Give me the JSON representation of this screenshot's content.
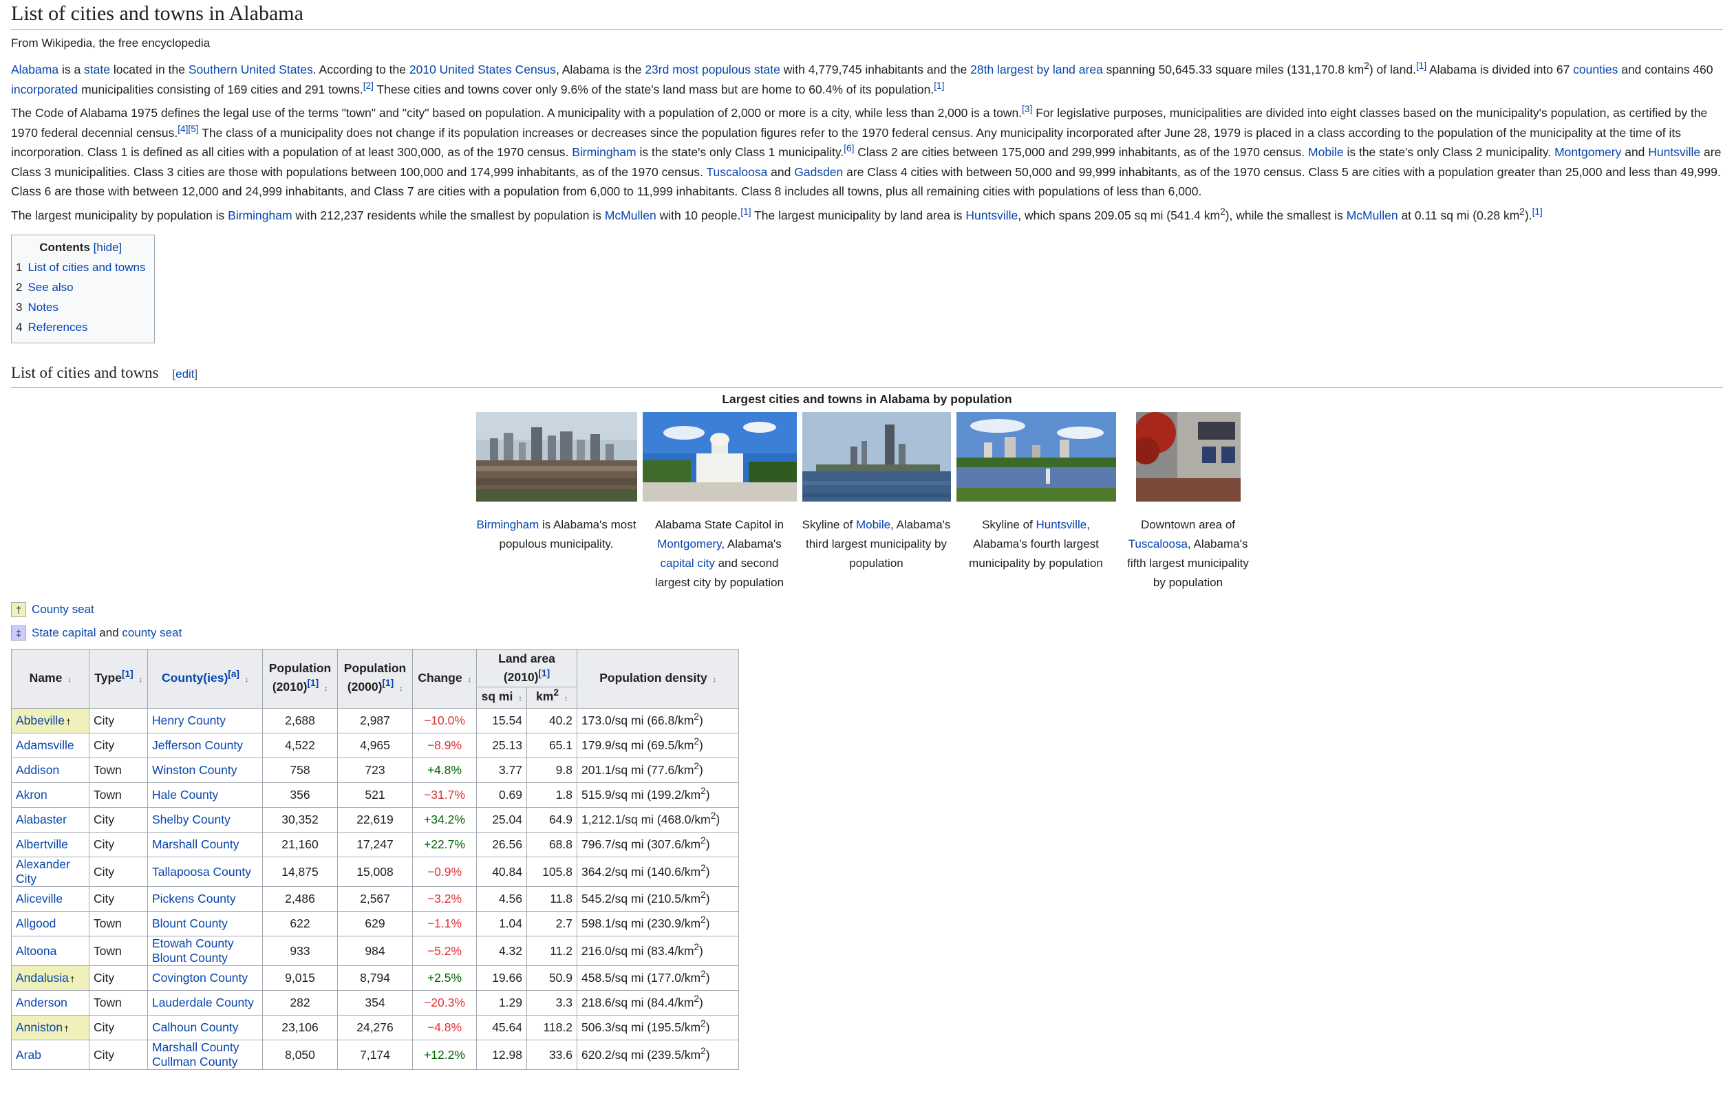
{
  "page": {
    "title": "List of cities and towns in Alabama",
    "tagline": "From Wikipedia, the free encyclopedia"
  },
  "intro": {
    "p1": {
      "alabama": "Alabama",
      "t1": " is a ",
      "state": "state",
      "t2": " located in the ",
      "southern_us": "Southern United States",
      "t3": ". According to the ",
      "census": "2010 United States Census",
      "t4": ", Alabama is the ",
      "populous": "23rd most populous state",
      "t5": " with 4,779,745 inhabitants and the ",
      "largest_area": "28th largest by land area",
      "t6": " spanning 50,645.33 square miles (131,170.8 km",
      "sup2": "2",
      "t7": ") of land.",
      "ref1": "[1]",
      "t8": " Alabama is divided into 67 ",
      "counties": "counties",
      "t9": " and contains 460 ",
      "incorporated": "incorporated",
      "t10": " municipalities consisting of 169 cities and 291 towns.",
      "ref2": "[2]",
      "t11": " These cities and towns cover only 9.6% of the state's land mass but are home to 60.4% of its population.",
      "ref1b": "[1]"
    },
    "p2": {
      "t1": "The Code of Alabama 1975 defines the legal use of the terms \"town\" and \"city\" based on population. A municipality with a population of 2,000 or more is a city, while less than 2,000 is a town.",
      "ref3": "[3]",
      "t2": " For legislative purposes, municipalities are divided into eight classes based on the municipality's population, as certified by the 1970 federal decennial census.",
      "ref45": "[4][5]",
      "t3": " The class of a municipality does not change if its population increases or decreases since the population figures refer to the 1970 federal census. Any municipality incorporated after June 28, 1979 is placed in a class according to the population of the municipality at the time of its incorporation. Class 1 is defined as all cities with a population of at least 300,000, as of the 1970 census. ",
      "birmingham": "Birmingham",
      "t4": " is the state's only Class 1 municipality.",
      "ref6": "[6]",
      "t5": " Class 2 are cities between 175,000 and 299,999 inhabitants, as of the 1970 census. ",
      "mobile": "Mobile",
      "t6": " is the state's only Class 2 municipality. ",
      "montgomery": "Montgomery",
      "t7": " and ",
      "huntsville": "Huntsville",
      "t8": " are Class 3 municipalities. Class 3 cities are those with populations between 100,000 and 174,999 inhabitants, as of the 1970 census. ",
      "tuscaloosa": "Tuscaloosa",
      "t9": " and ",
      "gadsden": "Gadsden",
      "t10": " are Class 4 cities with between 50,000 and 99,999 inhabitants, as of the 1970 census. Class 5 are cities with a population greater than 25,000 and less than 49,999. Class 6 are those with between 12,000 and 24,999 inhabitants, and Class 7 are cities with a population from 6,000 to 11,999 inhabitants. Class 8 includes all towns, plus all remaining cities with populations of less than 6,000."
    },
    "p3": {
      "t1": "The largest municipality by population is ",
      "birmingham": "Birmingham",
      "t2": " with 212,237 residents while the smallest by population is ",
      "mcmullen": "McMullen",
      "t3": " with 10 people.",
      "ref1": "[1]",
      "t4": " The largest municipality by land area is ",
      "huntsville": "Huntsville",
      "t5": ", which spans 209.05 sq mi (541.4 km",
      "sup2": "2",
      "t6": "), while the smallest is ",
      "mcmullen2": "McMullen",
      "t7": " at 0.11 sq mi (0.28 km",
      "sup2b": "2",
      "t8": ").",
      "ref1b": "[1]"
    }
  },
  "toc": {
    "title": "Contents",
    "hide": "[hide]",
    "items": [
      {
        "num": "1",
        "label": "List of cities and towns"
      },
      {
        "num": "2",
        "label": "See also"
      },
      {
        "num": "3",
        "label": "Notes"
      },
      {
        "num": "4",
        "label": "References"
      }
    ]
  },
  "section": {
    "title": "List of cities and towns",
    "edit": "edit",
    "lb": "[",
    "rb": "]"
  },
  "gallery": {
    "title": "Largest cities and towns in Alabama by population",
    "items": [
      {
        "link": "Birmingham",
        "text": " is Alabama's most populous municipality."
      },
      {
        "pre": "Alabama State Capitol in ",
        "link": "Montgomery",
        "mid": ", Alabama's ",
        "link2": "capital city",
        "text": " and second largest city by population"
      },
      {
        "pre": "Skyline of ",
        "link": "Mobile",
        "text": ", Alabama's third largest municipality by population"
      },
      {
        "pre": "Skyline of ",
        "link": "Huntsville",
        "text": ", Alabama's fourth largest municipality by population"
      },
      {
        "pre": "Downtown area of ",
        "link": "Tuscaloosa",
        "text": ", Alabama's fifth largest municipality by population"
      }
    ]
  },
  "legend": {
    "county_seat": {
      "symbol": "†",
      "label": "County seat",
      "color": "#eff0ba"
    },
    "capital": {
      "symbol": "‡",
      "label": "State capital",
      "and": " and ",
      "label2": "county seat",
      "color": "#ccccff"
    }
  },
  "table": {
    "headers": {
      "name": "Name",
      "type": "Type",
      "type_ref": "[1]",
      "county": "County(ies)",
      "county_ref": "[a]",
      "pop2010": "Population",
      "pop2010_sub": "(2010)",
      "pop2010_ref": "[1]",
      "pop2000": "Population",
      "pop2000_sub": "(2000)",
      "pop2000_ref": "[1]",
      "change": "Change",
      "land": "Land area",
      "land_sub": "(2010)",
      "land_ref": "[1]",
      "sqmi": "sq mi",
      "km2": "km",
      "km2_sup": "2",
      "density": "Population density"
    },
    "rows": [
      {
        "name": "Abbeville",
        "seat": true,
        "type": "City",
        "counties": [
          "Henry County"
        ],
        "pop2010": "2,688",
        "pop2000": "2,987",
        "change": "−10.0%",
        "dir": "neg",
        "sqmi": "15.54",
        "km2": "40.2",
        "density": "173.0/sq mi (66.8/km",
        "sup": "2",
        "close": ")"
      },
      {
        "name": "Adamsville",
        "seat": false,
        "type": "City",
        "counties": [
          "Jefferson County"
        ],
        "pop2010": "4,522",
        "pop2000": "4,965",
        "change": "−8.9%",
        "dir": "neg",
        "sqmi": "25.13",
        "km2": "65.1",
        "density": "179.9/sq mi (69.5/km",
        "sup": "2",
        "close": ")"
      },
      {
        "name": "Addison",
        "seat": false,
        "type": "Town",
        "counties": [
          "Winston County"
        ],
        "pop2010": "758",
        "pop2000": "723",
        "change": "+4.8%",
        "dir": "pos",
        "sqmi": "3.77",
        "km2": "9.8",
        "density": "201.1/sq mi (77.6/km",
        "sup": "2",
        "close": ")"
      },
      {
        "name": "Akron",
        "seat": false,
        "type": "Town",
        "counties": [
          "Hale County"
        ],
        "pop2010": "356",
        "pop2000": "521",
        "change": "−31.7%",
        "dir": "neg",
        "sqmi": "0.69",
        "km2": "1.8",
        "density": "515.9/sq mi (199.2/km",
        "sup": "2",
        "close": ")"
      },
      {
        "name": "Alabaster",
        "seat": false,
        "type": "City",
        "counties": [
          "Shelby County"
        ],
        "pop2010": "30,352",
        "pop2000": "22,619",
        "change": "+34.2%",
        "dir": "pos",
        "sqmi": "25.04",
        "km2": "64.9",
        "density": "1,212.1/sq mi (468.0/km",
        "sup": "2",
        "close": ")"
      },
      {
        "name": "Albertville",
        "seat": false,
        "type": "City",
        "counties": [
          "Marshall County"
        ],
        "pop2010": "21,160",
        "pop2000": "17,247",
        "change": "+22.7%",
        "dir": "pos",
        "sqmi": "26.56",
        "km2": "68.8",
        "density": "796.7/sq mi (307.6/km",
        "sup": "2",
        "close": ")"
      },
      {
        "name": "Alexander City",
        "seat": false,
        "type": "City",
        "counties": [
          "Tallapoosa County"
        ],
        "pop2010": "14,875",
        "pop2000": "15,008",
        "change": "−0.9%",
        "dir": "neg",
        "sqmi": "40.84",
        "km2": "105.8",
        "density": "364.2/sq mi (140.6/km",
        "sup": "2",
        "close": ")"
      },
      {
        "name": "Aliceville",
        "seat": false,
        "type": "City",
        "counties": [
          "Pickens County"
        ],
        "pop2010": "2,486",
        "pop2000": "2,567",
        "change": "−3.2%",
        "dir": "neg",
        "sqmi": "4.56",
        "km2": "11.8",
        "density": "545.2/sq mi (210.5/km",
        "sup": "2",
        "close": ")"
      },
      {
        "name": "Allgood",
        "seat": false,
        "type": "Town",
        "counties": [
          "Blount County"
        ],
        "pop2010": "622",
        "pop2000": "629",
        "change": "−1.1%",
        "dir": "neg",
        "sqmi": "1.04",
        "km2": "2.7",
        "density": "598.1/sq mi (230.9/km",
        "sup": "2",
        "close": ")"
      },
      {
        "name": "Altoona",
        "seat": false,
        "type": "Town",
        "counties": [
          "Etowah County",
          "Blount County"
        ],
        "pop2010": "933",
        "pop2000": "984",
        "change": "−5.2%",
        "dir": "neg",
        "sqmi": "4.32",
        "km2": "11.2",
        "density": "216.0/sq mi (83.4/km",
        "sup": "2",
        "close": ")"
      },
      {
        "name": "Andalusia",
        "seat": true,
        "type": "City",
        "counties": [
          "Covington County"
        ],
        "pop2010": "9,015",
        "pop2000": "8,794",
        "change": "+2.5%",
        "dir": "pos",
        "sqmi": "19.66",
        "km2": "50.9",
        "density": "458.5/sq mi (177.0/km",
        "sup": "2",
        "close": ")"
      },
      {
        "name": "Anderson",
        "seat": false,
        "type": "Town",
        "counties": [
          "Lauderdale County"
        ],
        "pop2010": "282",
        "pop2000": "354",
        "change": "−20.3%",
        "dir": "neg",
        "sqmi": "1.29",
        "km2": "3.3",
        "density": "218.6/sq mi (84.4/km",
        "sup": "2",
        "close": ")"
      },
      {
        "name": "Anniston",
        "seat": true,
        "type": "City",
        "counties": [
          "Calhoun County"
        ],
        "pop2010": "23,106",
        "pop2000": "24,276",
        "change": "−4.8%",
        "dir": "neg",
        "sqmi": "45.64",
        "km2": "118.2",
        "density": "506.3/sq mi (195.5/km",
        "sup": "2",
        "close": ")"
      },
      {
        "name": "Arab",
        "seat": false,
        "type": "City",
        "counties": [
          "Marshall County",
          "Cullman County"
        ],
        "pop2010": "8,050",
        "pop2000": "7,174",
        "change": "+12.2%",
        "dir": "pos",
        "sqmi": "12.98",
        "km2": "33.6",
        "density": "620.2/sq mi (239.5/km",
        "sup": "2",
        "close": ")"
      }
    ]
  },
  "icons": {
    "sort": "↕",
    "dagger": "†"
  }
}
